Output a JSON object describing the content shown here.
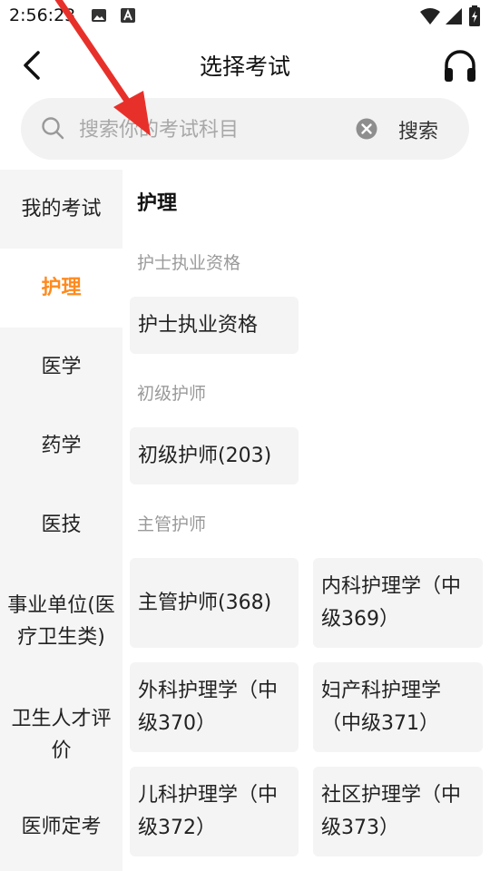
{
  "status_bar": {
    "time": "2:56:23"
  },
  "header": {
    "title": "选择考试",
    "back_icon": "chevron-left-icon",
    "right_icon": "headphone-icon"
  },
  "search": {
    "placeholder": "搜索你的考试科目",
    "value": "",
    "button_label": "搜索"
  },
  "sidebar": {
    "items": [
      {
        "label": "我的考试",
        "active": false
      },
      {
        "label": "护理",
        "active": true
      },
      {
        "label": "医学",
        "active": false
      },
      {
        "label": "药学",
        "active": false
      },
      {
        "label": "医技",
        "active": false
      },
      {
        "label": "事业单位(医疗卫生类)",
        "active": false
      },
      {
        "label": "卫生人才评价",
        "active": false
      },
      {
        "label": "医师定考",
        "active": false
      }
    ]
  },
  "content": {
    "section_title": "护理",
    "groups": [
      {
        "label": "护士执业资格",
        "exams": [
          "护士执业资格"
        ]
      },
      {
        "label": "初级护师",
        "exams": [
          "初级护师(203)"
        ]
      },
      {
        "label": "主管护师",
        "exams": [
          "主管护师(368)",
          "内科护理学（中级369）",
          "外科护理学（中级370）",
          "妇产科护理学（中级371）",
          "儿科护理学（中级372）",
          "社区护理学（中级373）"
        ]
      }
    ]
  },
  "colors": {
    "accent": "#ff8a1e",
    "annotation_arrow": "#e8302a"
  }
}
